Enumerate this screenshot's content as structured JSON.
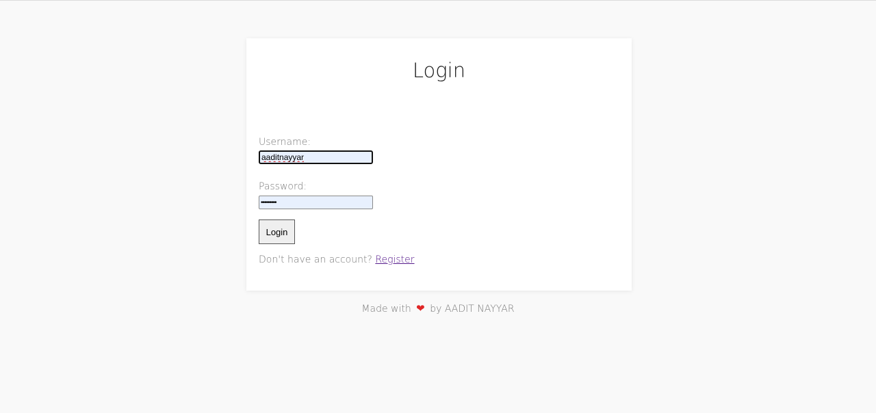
{
  "page": {
    "title": "Login",
    "accent_color": "#551a8b",
    "heart_color": "#e02626"
  },
  "form": {
    "username_label": "Username:",
    "username_value": "aaditnayyar",
    "password_label": "Password:",
    "password_value": "•••••••••",
    "submit_label": "Login",
    "register_prompt": "Don't have an account?",
    "register_link": "Register"
  },
  "footer": {
    "made_with": "Made with",
    "heart_icon": "heart-icon",
    "by_text": "by AADIT NAYYAR"
  }
}
